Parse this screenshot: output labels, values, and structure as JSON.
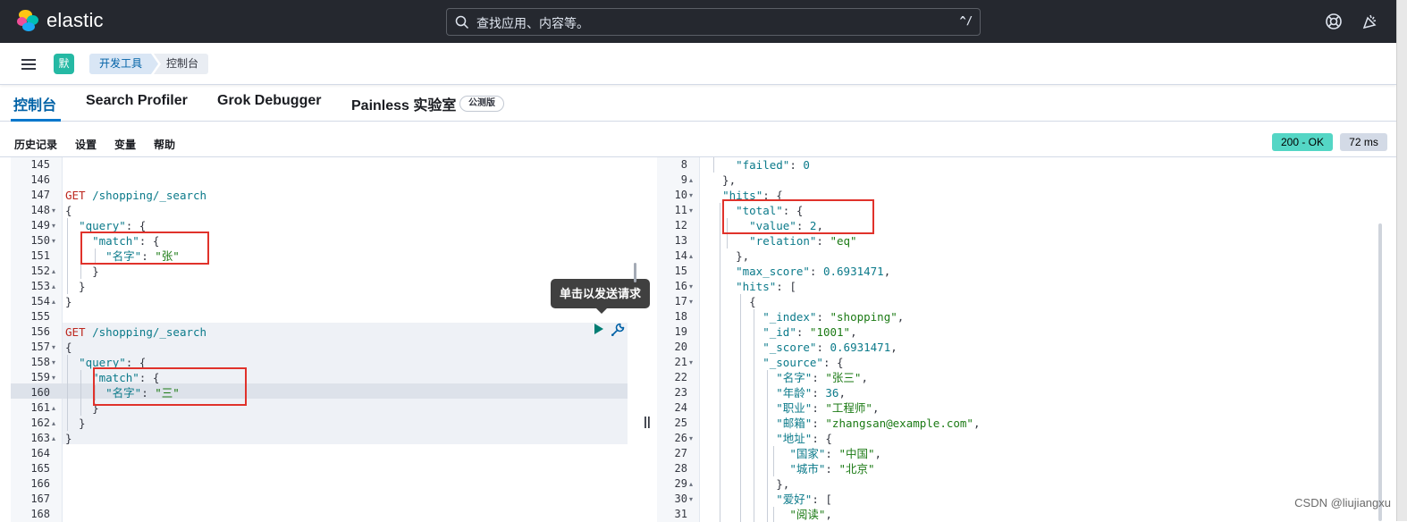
{
  "topbar": {
    "logo_text": "elastic",
    "search_placeholder": "查找应用、内容等。",
    "search_shortcut": "^/",
    "colors": {
      "bg": "#25282f"
    }
  },
  "navbar": {
    "space_initial": "默",
    "breadcrumb": [
      "开发工具",
      "控制台"
    ]
  },
  "tabs": [
    {
      "label": "控制台",
      "active": true
    },
    {
      "label": "Search Profiler",
      "active": false
    },
    {
      "label": "Grok Debugger",
      "active": false
    },
    {
      "label": "Painless 实验室",
      "active": false
    }
  ],
  "beta_badge": "公测版",
  "subnav": [
    "历史记录",
    "设置",
    "变量",
    "帮助"
  ],
  "response_status": {
    "status": "200 - OK",
    "time": "72 ms"
  },
  "tooltip": "单击以发送请求",
  "request_lines": [
    {
      "n": "145",
      "fold": "",
      "segs": []
    },
    {
      "n": "146",
      "fold": "",
      "segs": []
    },
    {
      "n": "147",
      "fold": "",
      "segs": [
        [
          "m",
          "GET"
        ],
        [
          "p",
          " "
        ],
        [
          "u",
          "/shopping/_search"
        ]
      ]
    },
    {
      "n": "148",
      "fold": "▾",
      "segs": [
        [
          "p",
          "{"
        ]
      ]
    },
    {
      "n": "149",
      "fold": "▾",
      "segs": [
        [
          "p",
          "  "
        ],
        [
          "k",
          "\"query\""
        ],
        [
          "p",
          ": {"
        ]
      ]
    },
    {
      "n": "150",
      "fold": "▾",
      "segs": [
        [
          "p",
          "    "
        ],
        [
          "k",
          "\"match\""
        ],
        [
          "p",
          ": {"
        ]
      ]
    },
    {
      "n": "151",
      "fold": "",
      "segs": [
        [
          "p",
          "      "
        ],
        [
          "k",
          "\"名字\""
        ],
        [
          "p",
          ": "
        ],
        [
          "s",
          "\"张\""
        ]
      ]
    },
    {
      "n": "152",
      "fold": "▴",
      "segs": [
        [
          "p",
          "    }"
        ]
      ]
    },
    {
      "n": "153",
      "fold": "▴",
      "segs": [
        [
          "p",
          "  }"
        ]
      ]
    },
    {
      "n": "154",
      "fold": "▴",
      "segs": [
        [
          "p",
          "}"
        ]
      ]
    },
    {
      "n": "155",
      "fold": "",
      "segs": []
    },
    {
      "n": "156",
      "fold": "",
      "segs": [
        [
          "m",
          "GET"
        ],
        [
          "p",
          " "
        ],
        [
          "u",
          "/shopping/_search"
        ]
      ]
    },
    {
      "n": "157",
      "fold": "▾",
      "segs": [
        [
          "p",
          "{"
        ]
      ]
    },
    {
      "n": "158",
      "fold": "▾",
      "segs": [
        [
          "p",
          "  "
        ],
        [
          "k",
          "\"query\""
        ],
        [
          "p",
          ": {"
        ]
      ]
    },
    {
      "n": "159",
      "fold": "▾",
      "segs": [
        [
          "p",
          "    "
        ],
        [
          "k",
          "\"match\""
        ],
        [
          "p",
          ": {"
        ]
      ]
    },
    {
      "n": "160",
      "fold": "",
      "segs": [
        [
          "p",
          "      "
        ],
        [
          "k",
          "\"名字\""
        ],
        [
          "p",
          ": "
        ],
        [
          "s",
          "\"三\""
        ]
      ]
    },
    {
      "n": "161",
      "fold": "▴",
      "segs": [
        [
          "p",
          "    }"
        ]
      ]
    },
    {
      "n": "162",
      "fold": "▴",
      "segs": [
        [
          "p",
          "  }"
        ]
      ]
    },
    {
      "n": "163",
      "fold": "▴",
      "segs": [
        [
          "p",
          "}"
        ]
      ]
    },
    {
      "n": "164",
      "fold": "",
      "segs": []
    },
    {
      "n": "165",
      "fold": "",
      "segs": []
    },
    {
      "n": "166",
      "fold": "",
      "segs": []
    },
    {
      "n": "167",
      "fold": "",
      "segs": []
    },
    {
      "n": "168",
      "fold": "",
      "segs": []
    }
  ],
  "response_lines": [
    {
      "n": "8",
      "fold": "",
      "segs": [
        [
          "p",
          "    "
        ],
        [
          "k",
          "\"failed\""
        ],
        [
          "p",
          ": "
        ],
        [
          "n",
          "0"
        ]
      ]
    },
    {
      "n": "9",
      "fold": "▴",
      "segs": [
        [
          "p",
          "  },"
        ]
      ]
    },
    {
      "n": "10",
      "fold": "▾",
      "segs": [
        [
          "p",
          "  "
        ],
        [
          "k",
          "\"hits\""
        ],
        [
          "p",
          ": {"
        ]
      ]
    },
    {
      "n": "11",
      "fold": "▾",
      "segs": [
        [
          "p",
          "    "
        ],
        [
          "k",
          "\"total\""
        ],
        [
          "p",
          ": {"
        ]
      ]
    },
    {
      "n": "12",
      "fold": "",
      "segs": [
        [
          "p",
          "      "
        ],
        [
          "k",
          "\"value\""
        ],
        [
          "p",
          ": "
        ],
        [
          "n",
          "2"
        ],
        [
          "p",
          ","
        ]
      ]
    },
    {
      "n": "13",
      "fold": "",
      "segs": [
        [
          "p",
          "      "
        ],
        [
          "k",
          "\"relation\""
        ],
        [
          "p",
          ": "
        ],
        [
          "s",
          "\"eq\""
        ]
      ]
    },
    {
      "n": "14",
      "fold": "▴",
      "segs": [
        [
          "p",
          "    },"
        ]
      ]
    },
    {
      "n": "15",
      "fold": "",
      "segs": [
        [
          "p",
          "    "
        ],
        [
          "k",
          "\"max_score\""
        ],
        [
          "p",
          ": "
        ],
        [
          "n",
          "0.6931471"
        ],
        [
          "p",
          ","
        ]
      ]
    },
    {
      "n": "16",
      "fold": "▾",
      "segs": [
        [
          "p",
          "    "
        ],
        [
          "k",
          "\"hits\""
        ],
        [
          "p",
          ": ["
        ]
      ]
    },
    {
      "n": "17",
      "fold": "▾",
      "segs": [
        [
          "p",
          "      {"
        ]
      ]
    },
    {
      "n": "18",
      "fold": "",
      "segs": [
        [
          "p",
          "        "
        ],
        [
          "k",
          "\"_index\""
        ],
        [
          "p",
          ": "
        ],
        [
          "s",
          "\"shopping\""
        ],
        [
          "p",
          ","
        ]
      ]
    },
    {
      "n": "19",
      "fold": "",
      "segs": [
        [
          "p",
          "        "
        ],
        [
          "k",
          "\"_id\""
        ],
        [
          "p",
          ": "
        ],
        [
          "s",
          "\"1001\""
        ],
        [
          "p",
          ","
        ]
      ]
    },
    {
      "n": "20",
      "fold": "",
      "segs": [
        [
          "p",
          "        "
        ],
        [
          "k",
          "\"_score\""
        ],
        [
          "p",
          ": "
        ],
        [
          "n",
          "0.6931471"
        ],
        [
          "p",
          ","
        ]
      ]
    },
    {
      "n": "21",
      "fold": "▾",
      "segs": [
        [
          "p",
          "        "
        ],
        [
          "k",
          "\"_source\""
        ],
        [
          "p",
          ": {"
        ]
      ]
    },
    {
      "n": "22",
      "fold": "",
      "segs": [
        [
          "p",
          "          "
        ],
        [
          "k",
          "\"名字\""
        ],
        [
          "p",
          ": "
        ],
        [
          "s",
          "\"张三\""
        ],
        [
          "p",
          ","
        ]
      ]
    },
    {
      "n": "23",
      "fold": "",
      "segs": [
        [
          "p",
          "          "
        ],
        [
          "k",
          "\"年龄\""
        ],
        [
          "p",
          ": "
        ],
        [
          "n",
          "36"
        ],
        [
          "p",
          ","
        ]
      ]
    },
    {
      "n": "24",
      "fold": "",
      "segs": [
        [
          "p",
          "          "
        ],
        [
          "k",
          "\"职业\""
        ],
        [
          "p",
          ": "
        ],
        [
          "s",
          "\"工程师\""
        ],
        [
          "p",
          ","
        ]
      ]
    },
    {
      "n": "25",
      "fold": "",
      "segs": [
        [
          "p",
          "          "
        ],
        [
          "k",
          "\"邮箱\""
        ],
        [
          "p",
          ": "
        ],
        [
          "s",
          "\"zhangsan@example.com\""
        ],
        [
          "p",
          ","
        ]
      ]
    },
    {
      "n": "26",
      "fold": "▾",
      "segs": [
        [
          "p",
          "          "
        ],
        [
          "k",
          "\"地址\""
        ],
        [
          "p",
          ": {"
        ]
      ]
    },
    {
      "n": "27",
      "fold": "",
      "segs": [
        [
          "p",
          "            "
        ],
        [
          "k",
          "\"国家\""
        ],
        [
          "p",
          ": "
        ],
        [
          "s",
          "\"中国\""
        ],
        [
          "p",
          ","
        ]
      ]
    },
    {
      "n": "28",
      "fold": "",
      "segs": [
        [
          "p",
          "            "
        ],
        [
          "k",
          "\"城市\""
        ],
        [
          "p",
          ": "
        ],
        [
          "s",
          "\"北京\""
        ]
      ]
    },
    {
      "n": "29",
      "fold": "▴",
      "segs": [
        [
          "p",
          "          },"
        ]
      ]
    },
    {
      "n": "30",
      "fold": "▾",
      "segs": [
        [
          "p",
          "          "
        ],
        [
          "k",
          "\"爱好\""
        ],
        [
          "p",
          ": ["
        ]
      ]
    },
    {
      "n": "31",
      "fold": "",
      "segs": [
        [
          "p",
          "            "
        ],
        [
          "s",
          "\"阅读\""
        ],
        [
          "p",
          ","
        ]
      ]
    }
  ],
  "watermark": "CSDN @liujiangxu"
}
